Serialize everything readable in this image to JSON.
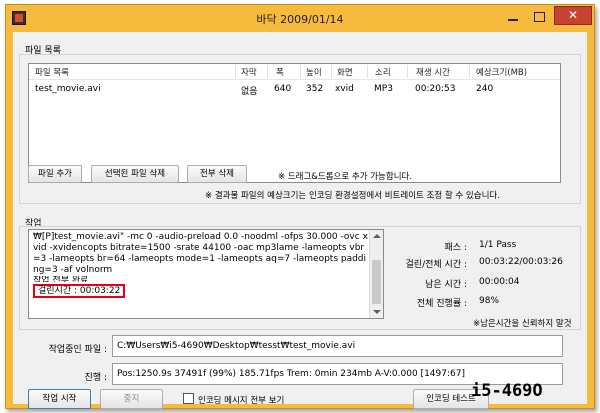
{
  "window": {
    "title": "바닥 2009/01/14",
    "close_label": "✕"
  },
  "file_list": {
    "section_label": "파일 목록",
    "columns": [
      "파일 목록",
      "자막",
      "폭",
      "높이",
      "화면",
      "소리",
      "재생 시간",
      "예상크기(MB)"
    ],
    "rows": [
      [
        "test_movie.avi",
        "없음",
        "640",
        "352",
        "xvid",
        "MP3",
        "00:20:53",
        "240"
      ]
    ]
  },
  "buttons": {
    "add_file": "파일 추가",
    "delete_selected": "선택된 파일 삭제",
    "delete_all": "전부 삭제",
    "start": "작업 시작",
    "stop": "중지",
    "encoding_test": "인코딩 테스트"
  },
  "notes": {
    "drag_drop": "※ 드래그&드롭으로 추가 가능합니다.",
    "bitrate": "※ 결과물 파일의 예상크기는 인코딩 환경설정에서 비트레이트 조정 할 수 있습니다.",
    "remaining_unreliable": "※남은시간을 신뢰하지 말것"
  },
  "job": {
    "section_label": "작업",
    "log_lines": [
      "₩[P]test_movie.avi\" -mc 0 -audio-preload 0.0 -noodml -ofps 30.000 -ovc xvid -xvidencopts bitrate=1500 -srate 44100 -oac mp3lame -lameopts vbr=3 -lameopts br=64 -lameopts mode=1 -lameopts aq=7 -lameopts padding=3 -af volnorm"
    ],
    "log_cut_line": "작업 전부 완료",
    "elapsed_highlight": "걸린시간 : 00:03:22",
    "stats": [
      {
        "label": "패스 :",
        "value": "1/1 Pass"
      },
      {
        "label": "걸린/전체 시간 :",
        "value": "00:03:22/00:03:26"
      },
      {
        "label": "남은 시간 :",
        "value": "00:00:04"
      },
      {
        "label": "전체 진행률 :",
        "value": "98%"
      }
    ],
    "current_file_label": "작업중인 파일 :",
    "current_file_value": "C:₩Users₩i5-4690₩Desktop₩tesst₩test_movie.avi",
    "progress_label": "진행 :",
    "progress_value": "Pos:1250.9s  37491f (99%) 185.71fps Trem:    0min 234mb  A-V:0.000 [1497:67]",
    "show_all_messages_label": "인코딩 메시지 전부 보기"
  },
  "watermark": "i5-469O"
}
